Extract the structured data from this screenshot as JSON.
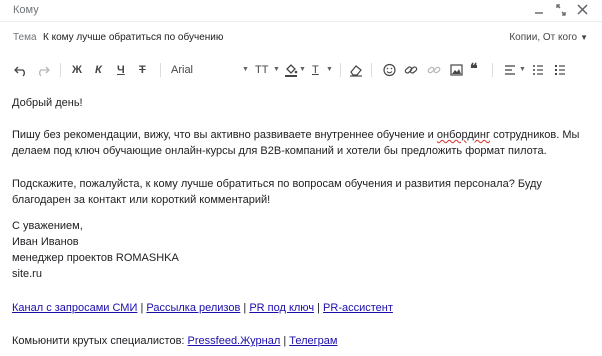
{
  "header": {
    "to_label": "Кому",
    "subject_label": "Тема",
    "subject_value": "К кому лучше обратиться по обучению",
    "copies_label": "Копии, От кого",
    "window_controls": [
      "minimize-icon",
      "expand-icon",
      "close-icon"
    ]
  },
  "toolbar": {
    "font_name": "Arial",
    "bold": "Ж",
    "italic": "К",
    "underline": "Ч",
    "strike": "Т",
    "text_size": "ТТ",
    "text_color": "Т"
  },
  "body": {
    "greeting": "Добрый день!",
    "p1_line1": "Пишу без рекомендации, вижу, что вы активно развиваете внутреннее обучение и ",
    "p1_word": "онбординг",
    "p1_line1_end": " сотрудников. Мы",
    "p1_line2": "делаем под ключ обучающие онлайн-курсы для B2B-компаний и хотели бы предложить формат пилота.",
    "p2_line1": "Подскажите, пожалуйста, к кому лучше обратиться по вопросам обучения и развития персонала? Буду",
    "p2_line2": "благодарен за контакт или короткий комментарий!",
    "sign_regards": "С уважением,",
    "sign_name": "Иван Иванов",
    "sign_title": "менеджер проектов ROMASHKA",
    "sign_site": "site.ru"
  },
  "links": {
    "l1": "Канал с запросами СМИ",
    "l2": "Рассылка релизов",
    "l3": "PR под ключ",
    "l4": "PR-ассистент",
    "pipe": "|",
    "community_prefix": "Комьюнити крутых специалистов: ",
    "c1": "Pressfeed.Журнал",
    "c2": "Телеграм"
  }
}
